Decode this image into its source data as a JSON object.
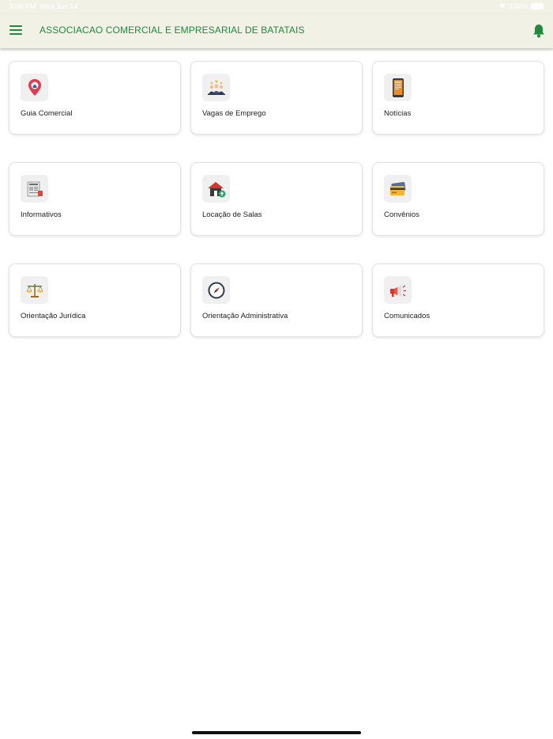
{
  "status_bar": {
    "time": "8:08 PM",
    "date": "Wed Jun 14",
    "battery": "100%"
  },
  "header": {
    "title": "ASSOCIACAO COMERCIAL E EMPRESARIAL DE BATATAIS",
    "accent_color": "#1f8a3c"
  },
  "menu": [
    {
      "label": "Guia Comercial",
      "icon": "map-pin-icon"
    },
    {
      "label": "Vagas de Emprego",
      "icon": "workers-icon"
    },
    {
      "label": "Notícias",
      "icon": "phone-news-icon"
    },
    {
      "label": "Informativos",
      "icon": "newspaper-icon"
    },
    {
      "label": "Locação de Salas",
      "icon": "house-icon"
    },
    {
      "label": "Convênios",
      "icon": "credit-card-icon"
    },
    {
      "label": "Orientação Jurídica",
      "icon": "scales-icon"
    },
    {
      "label": "Orientação Administrativa",
      "icon": "compass-icon"
    },
    {
      "label": "Comunicados",
      "icon": "megaphone-icon"
    }
  ]
}
